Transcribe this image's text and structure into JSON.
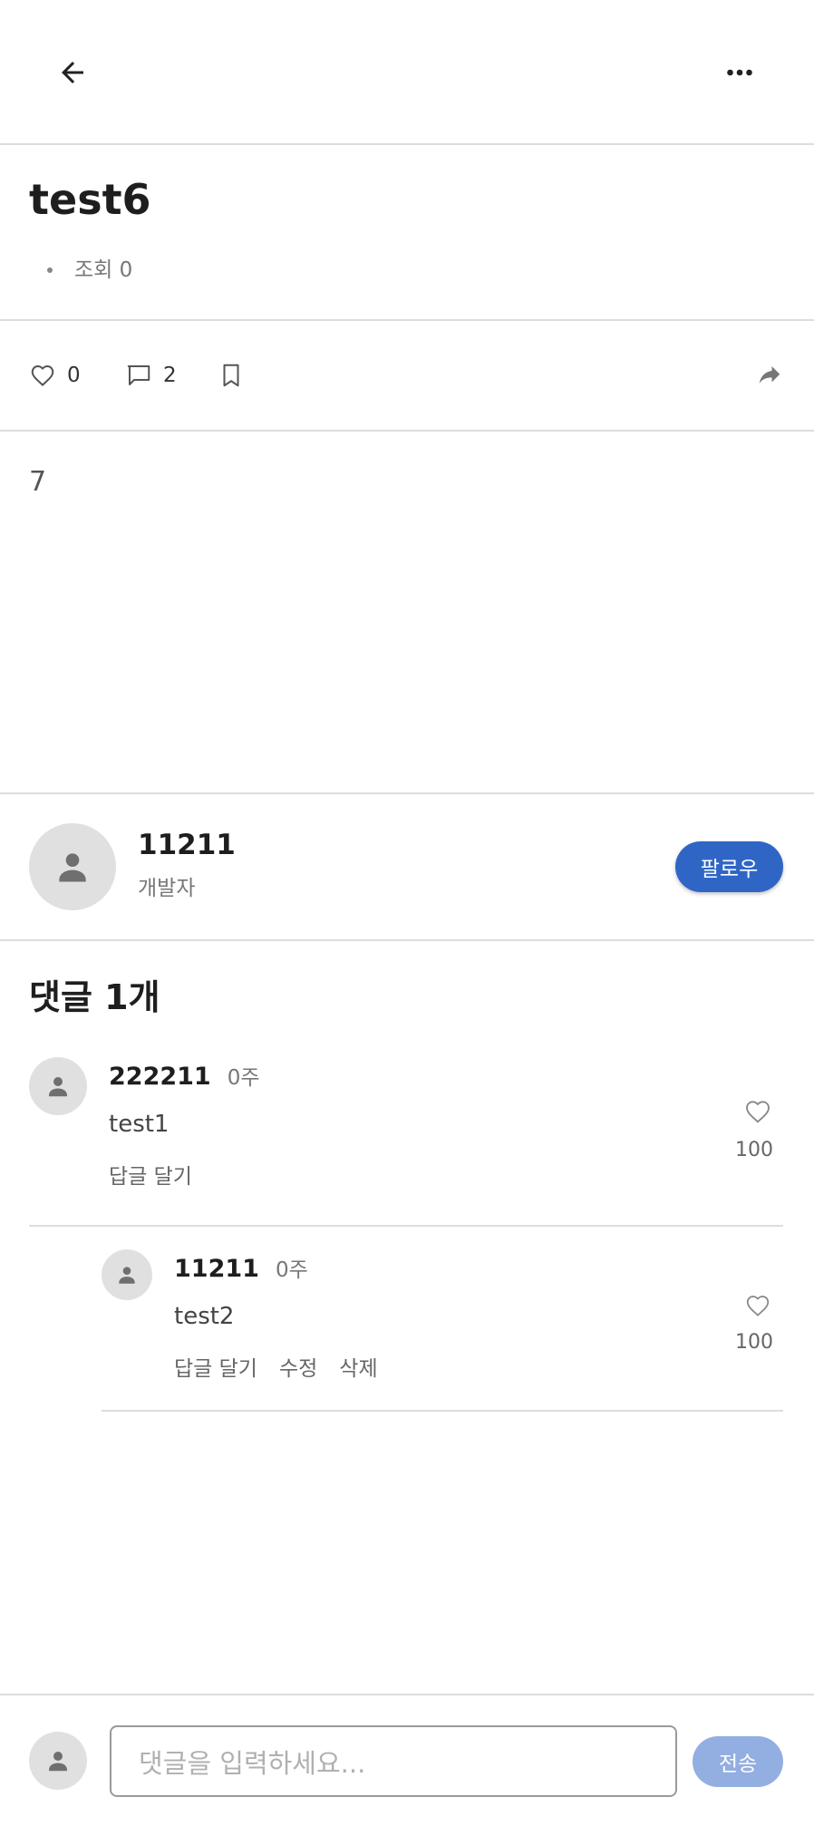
{
  "post": {
    "title": "test6",
    "views": "조회 0",
    "body": "7",
    "likes": "0",
    "comments": "2"
  },
  "author": {
    "name": "11211",
    "role": "개발자",
    "follow_label": "팔로우"
  },
  "comments_section": {
    "title": "댓글 1개",
    "items": [
      {
        "name": "222211",
        "time": "0주",
        "text": "test1",
        "reply_label": "답글 달기",
        "like_count": "100"
      },
      {
        "name": "11211",
        "time": "0주",
        "text": "test2",
        "reply_label": "답글 달기",
        "edit_label": "수정",
        "delete_label": "삭제",
        "like_count": "100"
      }
    ]
  },
  "composer": {
    "placeholder": "댓글을 입력하세요...",
    "send_label": "전송"
  },
  "colors": {
    "accent": "#2f66c6",
    "send_disabled": "#93aee0",
    "divider": "#dddddd"
  },
  "icons": [
    "back-arrow-icon",
    "more-icon",
    "heart-icon",
    "comment-icon",
    "bookmark-icon",
    "share-icon",
    "person-icon"
  ]
}
